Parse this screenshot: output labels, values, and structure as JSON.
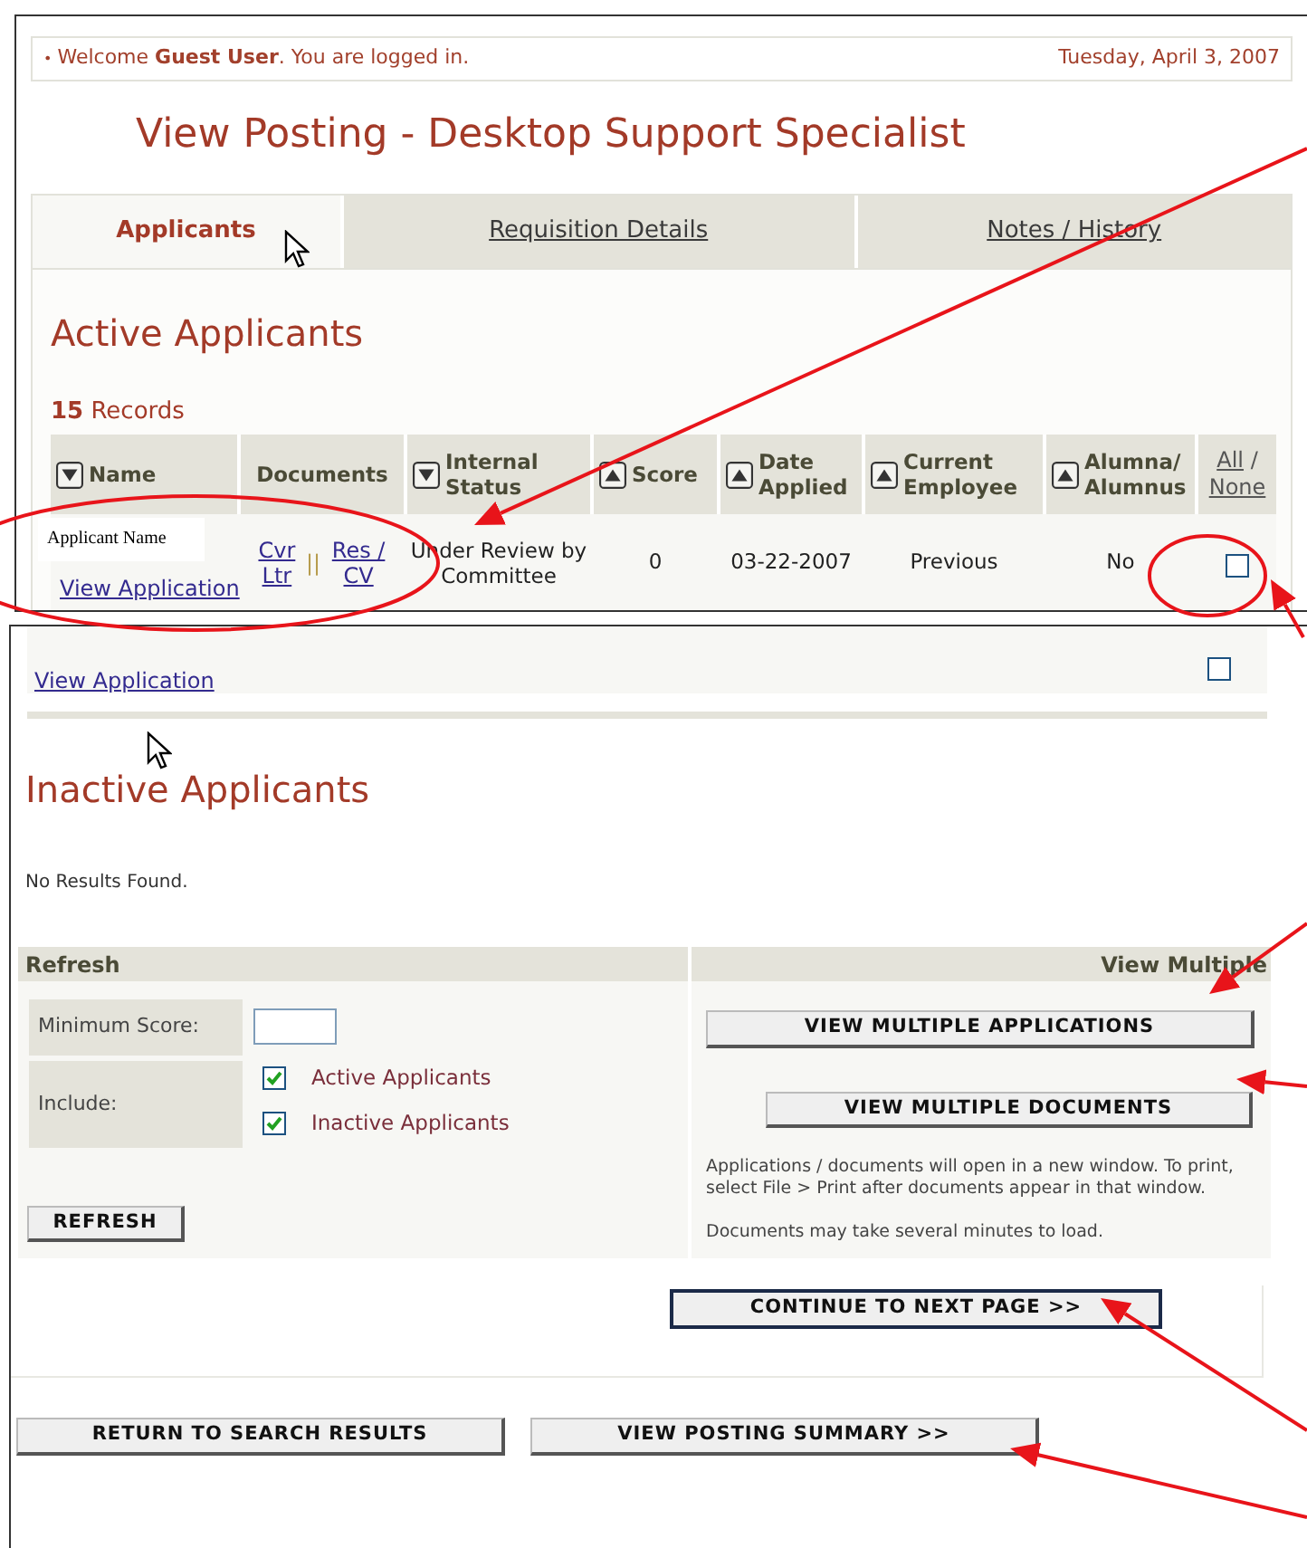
{
  "header": {
    "bullet": "•",
    "welcome": "Welcome **Guest User**. You are logged in.",
    "date": "Tuesday, April 3, 2007"
  },
  "title": "View Posting - Desktop Support Specialist",
  "tabs": [
    {
      "label": "Applicants",
      "selected": true
    },
    {
      "label": "Requisition Details",
      "selected": false
    },
    {
      "label": "Notes / History",
      "selected": false
    }
  ],
  "active_section": {
    "heading": "Active Applicants",
    "records": "**15** Records",
    "columns": [
      {
        "label": "Name",
        "kind": "sort-down"
      },
      {
        "label": "Documents",
        "kind": "plain"
      },
      {
        "label": "Internal Status",
        "kind": "sort-down"
      },
      {
        "label": "Score",
        "kind": "sort-up"
      },
      {
        "label": "Date Applied",
        "kind": "sort-up"
      },
      {
        "label": "Current Employee",
        "kind": "sort-up"
      },
      {
        "label": "Alumna/ Alumnus",
        "kind": "sort-up"
      }
    ],
    "select_all": "All",
    "select_separator": "/",
    "select_none": "None",
    "rows": [
      {
        "name_label": "Applicant Name",
        "view_link": "View Application",
        "documents": [
          "Cvr Ltr",
          "Res / CV"
        ],
        "documents_separator": "||",
        "status": "Under Review by Committee",
        "score": "0",
        "date": "03-22-2007",
        "current_employee": "Previous",
        "alumnus": "No",
        "checked": false
      }
    ]
  },
  "continued_row": {
    "view_link": "View Application",
    "checked": false
  },
  "inactive_section": {
    "heading": "Inactive Applicants",
    "message": "No Results Found."
  },
  "refresh_panel": {
    "title": "Refresh",
    "min_score_label": "Minimum Score:",
    "include_label": "Include:",
    "options": [
      {
        "label": "Active Applicants",
        "checked": true
      },
      {
        "label": "Inactive Applicants",
        "checked": true
      }
    ],
    "button": "REFRESH"
  },
  "view_multiple_panel": {
    "title": "View Multiple",
    "buttons": [
      "VIEW MULTIPLE APPLICATIONS",
      "VIEW MULTIPLE DOCUMENTS"
    ],
    "notes": [
      "Applications / documents will open in a new window. To print, select File > Print after documents appear in that window.",
      "Documents may take several minutes to load."
    ]
  },
  "continue_button": "CONTINUE TO NEXT PAGE >>",
  "bottom_buttons": [
    "RETURN TO SEARCH RESULTS",
    "VIEW POSTING SUMMARY >>"
  ]
}
